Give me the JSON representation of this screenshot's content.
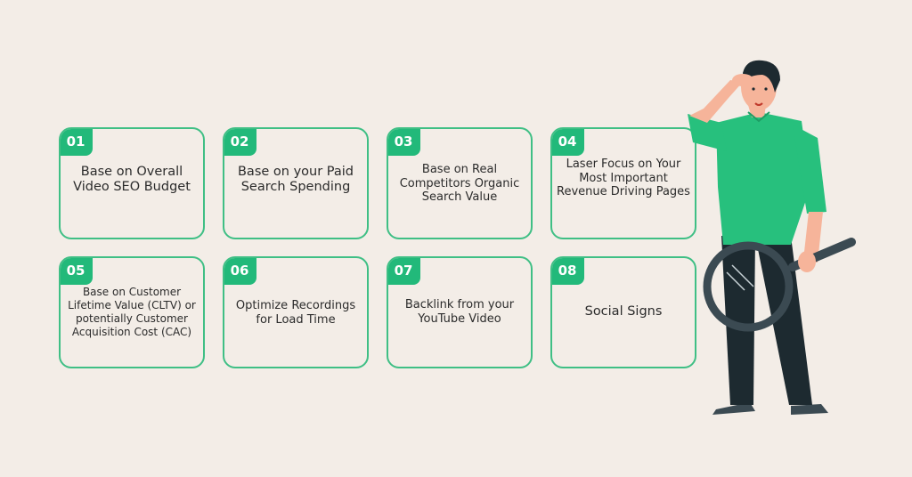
{
  "colors": {
    "background": "#f3ede7",
    "accent": "#22b97a",
    "card_border": "#3fbf85",
    "text": "#2b2b2b",
    "shirt": "#27c07d",
    "pants": "#1d2a30",
    "skin": "#f6b49a"
  },
  "cards": [
    {
      "number": "01",
      "text": "Base on Overall Video SEO Budget"
    },
    {
      "number": "02",
      "text": "Base on your Paid Search Spending"
    },
    {
      "number": "03",
      "text": "Base on Real Competitors Organic Search Value"
    },
    {
      "number": "04",
      "text": "Laser Focus on Your Most Important Revenue Driving Pages"
    },
    {
      "number": "05",
      "text": "Base on Customer Lifetime Value (CLTV) or potentially Customer Acquisition Cost (CAC)"
    },
    {
      "number": "06",
      "text": "Optimize Recordings for Load Time"
    },
    {
      "number": "07",
      "text": "Backlink from your YouTube Video"
    },
    {
      "number": "08",
      "text": "Social Signs"
    }
  ],
  "illustration": {
    "subject": "man-with-magnifying-glass-illustration"
  }
}
